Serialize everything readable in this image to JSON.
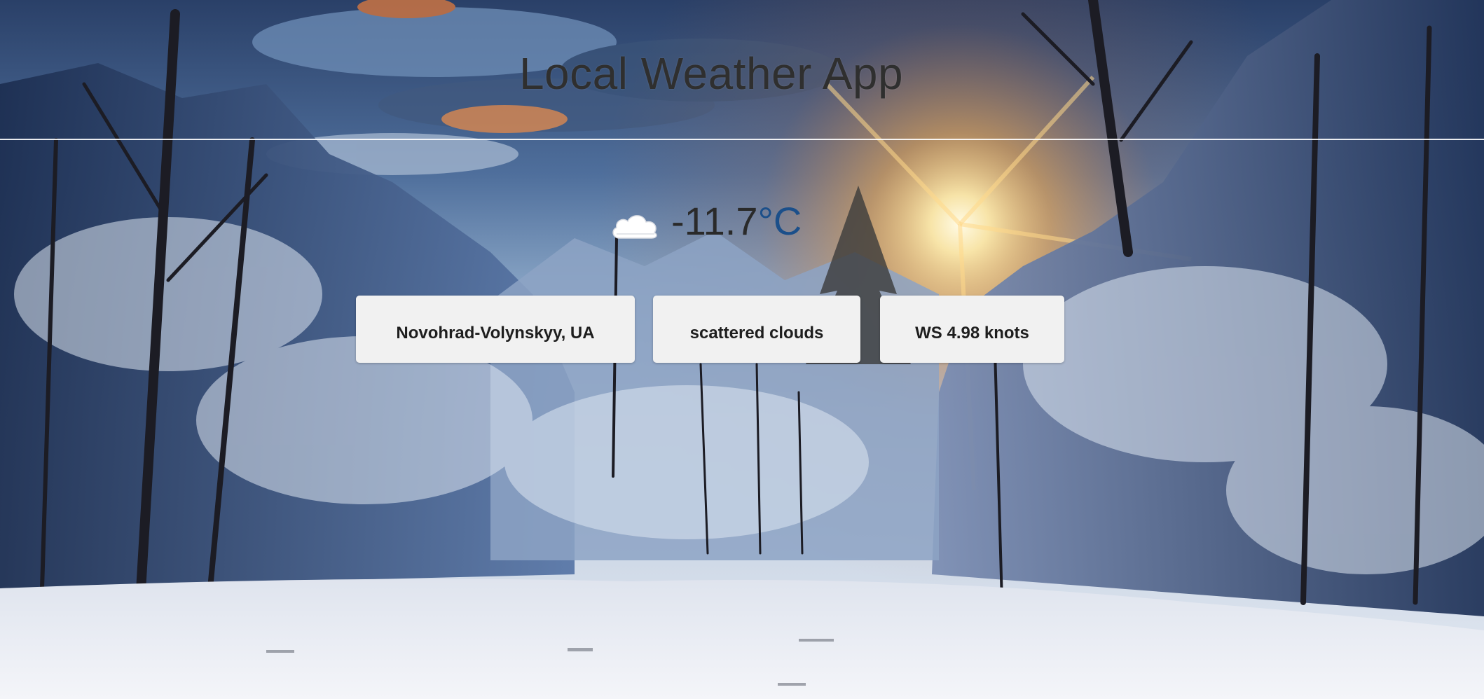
{
  "header": {
    "title": "Local Weather App"
  },
  "weather": {
    "icon": "cloud-icon",
    "temperature": "-11.7",
    "unit": "°C",
    "location": "Novohrad-Volynskyy, UA",
    "description": "scattered clouds",
    "wind": "WS 4.98 knots"
  },
  "colors": {
    "title": "#2f2f2f",
    "unit_link": "#1b4f8a",
    "card_bg": "#f1f1f1"
  }
}
